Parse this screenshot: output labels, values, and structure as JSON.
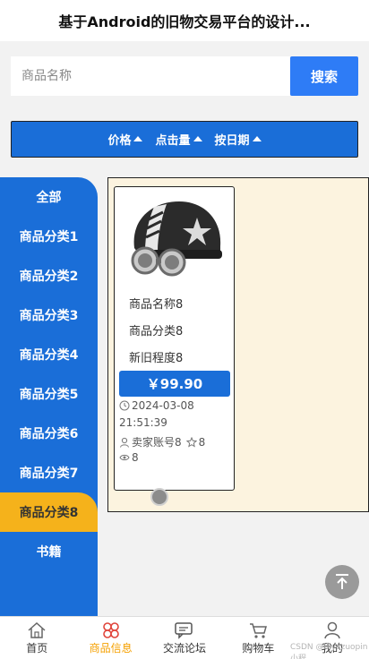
{
  "header": {
    "title": "基于Android的旧物交易平台的设计..."
  },
  "search": {
    "placeholder": "商品名称",
    "button_label": "搜索"
  },
  "sort": {
    "items": [
      {
        "label": "价格"
      },
      {
        "label": "点击量"
      },
      {
        "label": "按日期"
      }
    ]
  },
  "categories": [
    {
      "label": "全部"
    },
    {
      "label": "商品分类1"
    },
    {
      "label": "商品分类2"
    },
    {
      "label": "商品分类3"
    },
    {
      "label": "商品分类4"
    },
    {
      "label": "商品分类5"
    },
    {
      "label": "商品分类6"
    },
    {
      "label": "商品分类7"
    },
    {
      "label": "商品分类8"
    },
    {
      "label": "书籍"
    }
  ],
  "active_category": "商品分类8",
  "product": {
    "name": "商品名称8",
    "category": "商品分类8",
    "condition": "新旧程度8",
    "price": "￥99.90",
    "date": "2024-03-08",
    "time": "21:51:39",
    "seller": "卖家账号8",
    "favorites": "8",
    "views": "8"
  },
  "tabbar": {
    "items": [
      {
        "label": "首页",
        "icon": "home-icon"
      },
      {
        "label": "商品信息",
        "icon": "goods-icon"
      },
      {
        "label": "交流论坛",
        "icon": "forum-icon"
      },
      {
        "label": "购物车",
        "icon": "cart-icon"
      },
      {
        "label": "我的",
        "icon": "user-icon"
      }
    ],
    "active": "商品信息"
  },
  "watermark": "CSDN @biyezuopin小程",
  "colors": {
    "primary_blue": "#1a6ed8",
    "search_blue": "#2e7cf6",
    "active_yellow": "#f5b21b",
    "content_bg": "#fcf3df"
  }
}
